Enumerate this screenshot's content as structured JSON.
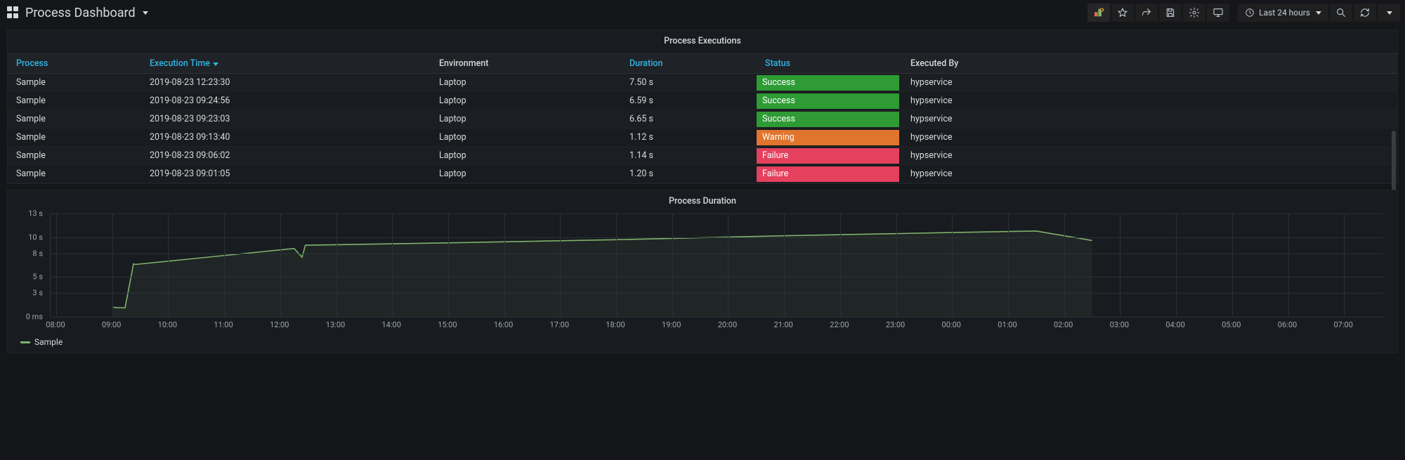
{
  "header": {
    "dashboard_title": "Process Dashboard",
    "time_range_label": "Last 24 hours"
  },
  "table_panel": {
    "title": "Process Executions",
    "columns": {
      "process": "Process",
      "execution_time": "Execution Time",
      "environment": "Environment",
      "duration": "Duration",
      "status": "Status",
      "executed_by": "Executed By"
    },
    "sorted_column": "execution_time",
    "sort_dir": "desc",
    "rows": [
      {
        "process": "Sample",
        "execution_time": "2019-08-23 12:23:30",
        "environment": "Laptop",
        "duration": "7.50 s",
        "status": "Success",
        "executed_by": "hypservice"
      },
      {
        "process": "Sample",
        "execution_time": "2019-08-23 09:24:56",
        "environment": "Laptop",
        "duration": "6.59 s",
        "status": "Success",
        "executed_by": "hypservice"
      },
      {
        "process": "Sample",
        "execution_time": "2019-08-23 09:23:03",
        "environment": "Laptop",
        "duration": "6.65 s",
        "status": "Success",
        "executed_by": "hypservice"
      },
      {
        "process": "Sample",
        "execution_time": "2019-08-23 09:13:40",
        "environment": "Laptop",
        "duration": "1.12 s",
        "status": "Warning",
        "executed_by": "hypservice"
      },
      {
        "process": "Sample",
        "execution_time": "2019-08-23 09:06:02",
        "environment": "Laptop",
        "duration": "1.14 s",
        "status": "Failure",
        "executed_by": "hypservice"
      },
      {
        "process": "Sample",
        "execution_time": "2019-08-23 09:01:05",
        "environment": "Laptop",
        "duration": "1.20 s",
        "status": "Failure",
        "executed_by": "hypservice"
      }
    ]
  },
  "chart_panel": {
    "title": "Process Duration",
    "legend_label": "Sample"
  },
  "chart_data": {
    "type": "line",
    "title": "Process Duration",
    "xlabel": "",
    "ylabel": "",
    "y_ticks": [
      "0 ms",
      "3 s",
      "5 s",
      "8 s",
      "10 s",
      "13 s"
    ],
    "y_tick_values": [
      0,
      3,
      5,
      8,
      10,
      13
    ],
    "ylim": [
      0,
      13
    ],
    "x_ticks": [
      "08:00",
      "09:00",
      "10:00",
      "11:00",
      "12:00",
      "13:00",
      "14:00",
      "15:00",
      "16:00",
      "17:00",
      "18:00",
      "19:00",
      "20:00",
      "21:00",
      "22:00",
      "23:00",
      "00:00",
      "01:00",
      "02:00",
      "03:00",
      "04:00",
      "05:00",
      "06:00",
      "07:00"
    ],
    "xlim_hours": [
      7.9,
      7.7
    ],
    "series": [
      {
        "name": "Sample",
        "color": "#7eb26d",
        "points": [
          {
            "t_h": 9.02,
            "y_s": 1.2
          },
          {
            "t_h": 9.1,
            "y_s": 1.14
          },
          {
            "t_h": 9.23,
            "y_s": 1.12
          },
          {
            "t_h": 9.38,
            "y_s": 6.65
          },
          {
            "t_h": 9.42,
            "y_s": 6.59
          },
          {
            "t_h": 12.25,
            "y_s": 8.6
          },
          {
            "t_h": 12.39,
            "y_s": 7.5
          },
          {
            "t_h": 12.45,
            "y_s": 9.0
          },
          {
            "t_h": 15.0,
            "y_s": 9.3
          },
          {
            "t_h": 18.0,
            "y_s": 9.7
          },
          {
            "t_h": 21.0,
            "y_s": 10.2
          },
          {
            "t_h": 24.0,
            "y_s": 10.6
          },
          {
            "t_h": 25.5,
            "y_s": 10.8
          },
          {
            "t_h": 26.5,
            "y_s": 9.6
          }
        ]
      }
    ]
  }
}
